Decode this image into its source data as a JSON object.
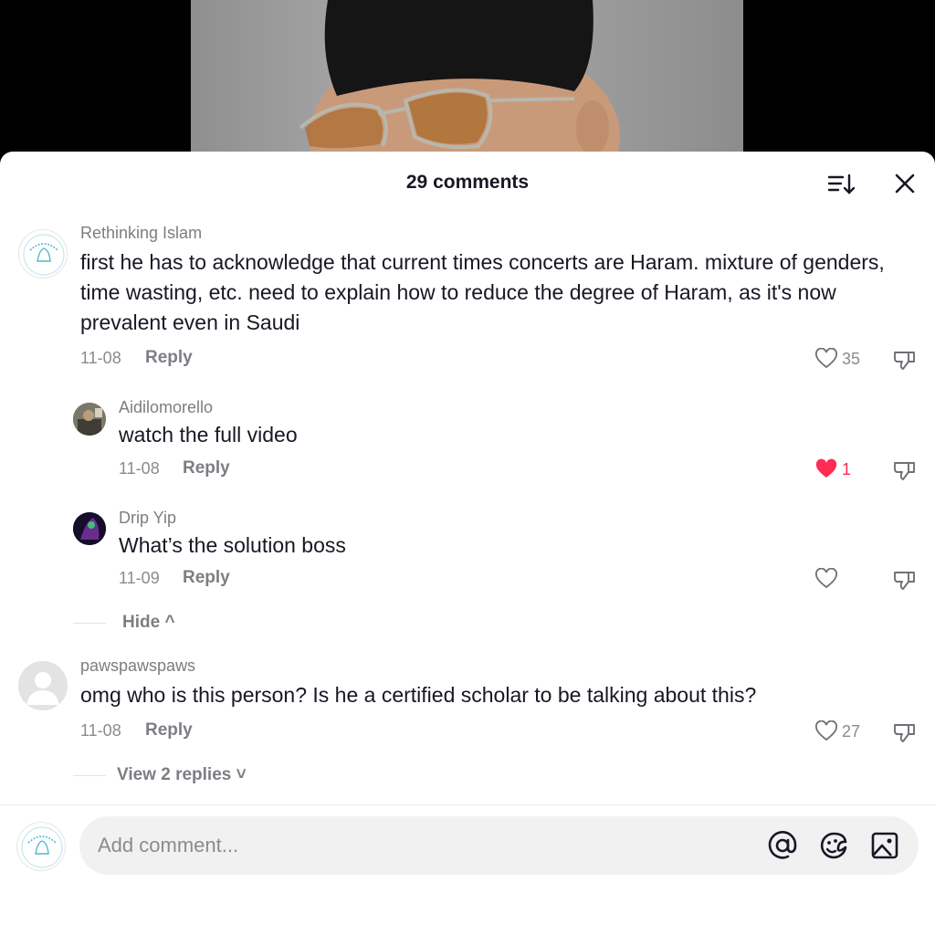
{
  "header": {
    "title": "29 comments"
  },
  "comments": [
    {
      "author": "Rethinking Islam",
      "text": "first he has to acknowledge that current times concerts are Haram. mixture of genders, time wasting, etc. need to explain how to reduce the degree of Haram, as it's now prevalent even in Saudi",
      "date": "11-08",
      "reply_label": "Reply",
      "likes": "35",
      "liked": false,
      "replies": [
        {
          "author": "Aidilomorello",
          "text": "watch the full video",
          "date": "11-08",
          "reply_label": "Reply",
          "likes": "1",
          "liked": true
        },
        {
          "author": "Drip Yip",
          "text": "What’s the solution boss",
          "date": "11-09",
          "reply_label": "Reply",
          "likes": "",
          "liked": false
        }
      ],
      "toggle_label": "Hide ^"
    },
    {
      "author": "pawspawspaws",
      "text": "omg who is this person? Is he a certified scholar to be talking about this?",
      "date": "11-08",
      "reply_label": "Reply",
      "likes": "27",
      "liked": false,
      "toggle_label": "View 2 replies ˅"
    }
  ],
  "composer": {
    "placeholder": "Add comment..."
  },
  "icons": {
    "sort": "sort-icon",
    "close": "close-icon",
    "like": "heart-icon",
    "dislike": "thumbs-down-icon",
    "mention": "at-sign-icon",
    "emoji": "emoji-icon",
    "image": "image-icon"
  },
  "colors": {
    "liked": "#fe2c55",
    "text": "#161823",
    "muted": "#8a8b91",
    "input_bg": "#f1f1f2"
  }
}
